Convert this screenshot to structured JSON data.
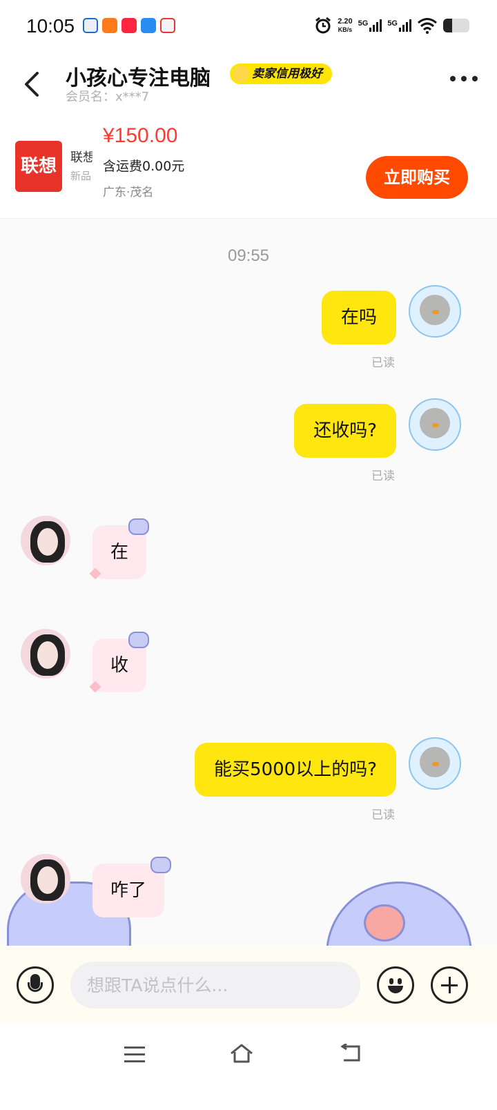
{
  "status": {
    "time": "10:05",
    "net_speed": "2.20",
    "net_speed_unit": "KB/s",
    "sim1": "5G",
    "sim2": "5G",
    "battery_level": 0.35
  },
  "header": {
    "title": "小孩心专注电脑",
    "badge": "卖家信用极好",
    "member_name": "会员名：x***7"
  },
  "product": {
    "thumb_brand": "联想",
    "thumb_title": "联想",
    "thumb_sub": "新品",
    "price": "¥150.00",
    "shipping": "含运费0.00元",
    "location": "广东·茂名",
    "buy_label": "立即购买"
  },
  "chat": {
    "timestamp": "09:55",
    "messages": [
      {
        "side": "out",
        "text": "在吗",
        "status": "已读"
      },
      {
        "side": "out",
        "text": "还收吗?",
        "status": "已读"
      },
      {
        "side": "in",
        "text": "在"
      },
      {
        "side": "in",
        "text": "收"
      },
      {
        "side": "out",
        "text": "能买5000以上的吗?",
        "status": "已读"
      },
      {
        "side": "in",
        "text": "咋了"
      }
    ]
  },
  "input": {
    "placeholder": "想跟TA说点什么..."
  },
  "colors": {
    "accent_yellow": "#ffe60f",
    "buy_orange": "#ff4a00",
    "price_red": "#ff3b30",
    "incoming_bubble": "#ffe9ef"
  },
  "icons": [
    "back-icon",
    "more-icon",
    "mic-icon",
    "emoji-icon",
    "plus-icon",
    "menu-icon",
    "home-icon",
    "back-nav-icon"
  ]
}
